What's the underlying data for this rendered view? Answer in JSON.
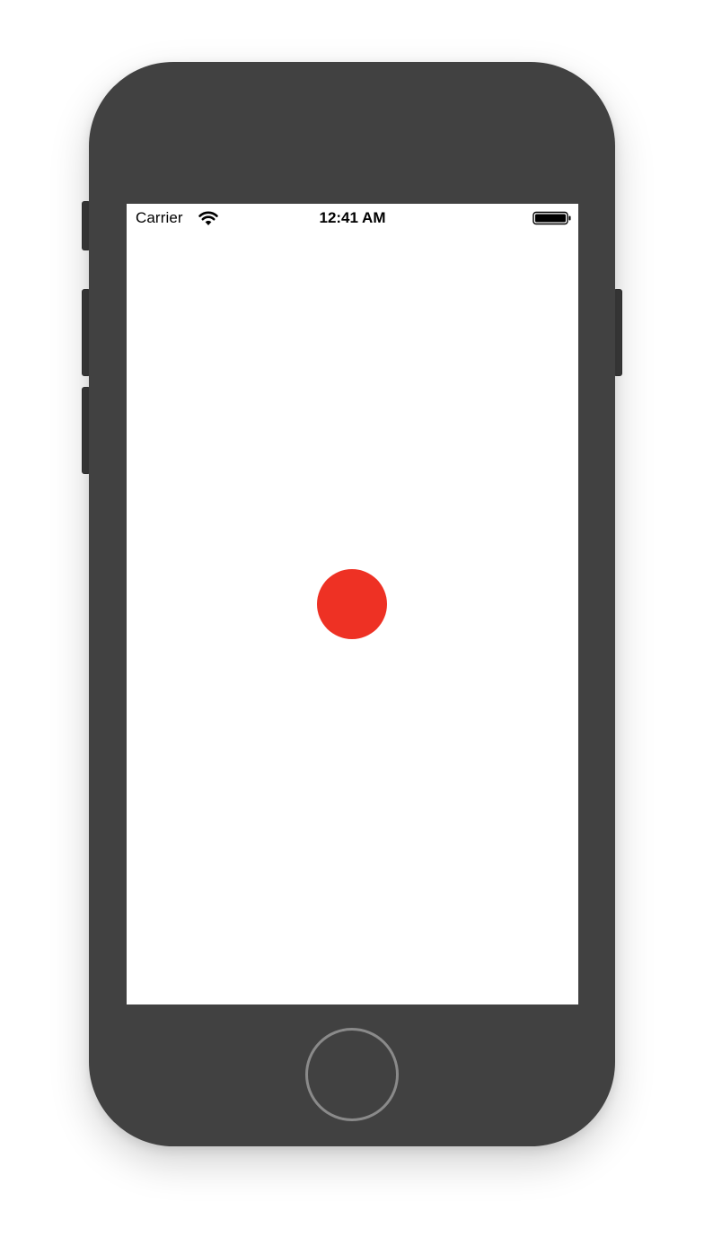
{
  "status_bar": {
    "carrier": "Carrier",
    "time": "12:41 AM",
    "wifi_icon": "wifi-icon",
    "battery_icon": "battery-icon"
  },
  "content": {
    "dot_color": "#EE3124"
  },
  "device": {
    "body_color": "#414141",
    "home_button_icon": "home-button"
  }
}
